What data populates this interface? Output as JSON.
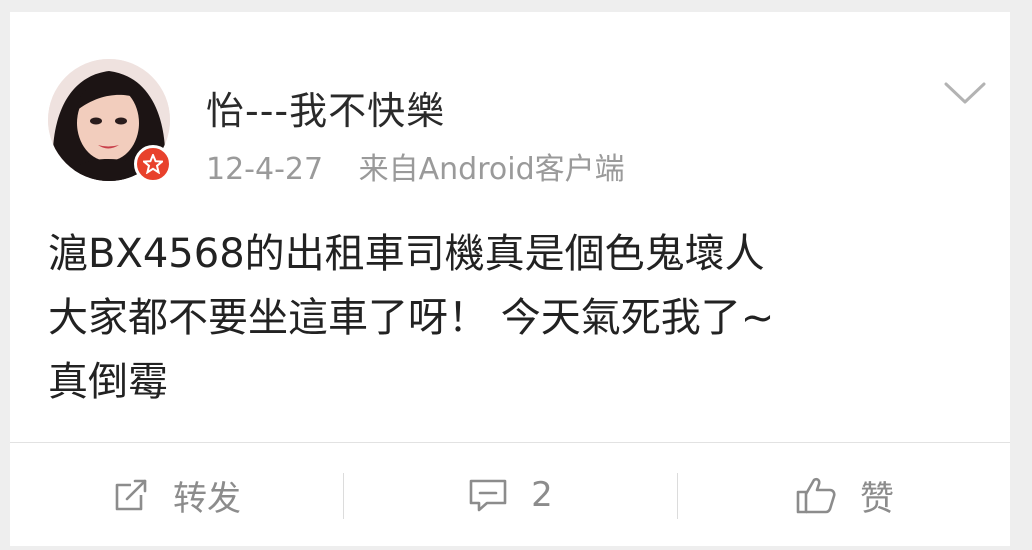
{
  "post": {
    "author": {
      "name": "怡---我不快樂",
      "avatar": "avatar-photo",
      "badge": "vip-badge-icon"
    },
    "date": "12-4-27",
    "source": "来自Android客户端",
    "menu_icon": "chevron-down-icon",
    "text_lines": [
      "滬BX4568的出租車司機真是個色鬼壞人",
      "大家都不要坐這車了呀！ 今天氣死我了~",
      "真倒霉"
    ]
  },
  "actions": {
    "repost": {
      "label": "转发",
      "icon": "repost-icon"
    },
    "comment": {
      "count": "2",
      "icon": "comment-icon"
    },
    "like": {
      "label": "赞",
      "icon": "thumbs-up-icon"
    }
  },
  "colors": {
    "background": "#eeeeee",
    "card": "#ffffff",
    "text": "#222222",
    "muted": "#9a9a9a",
    "badge": "#e8412c"
  }
}
